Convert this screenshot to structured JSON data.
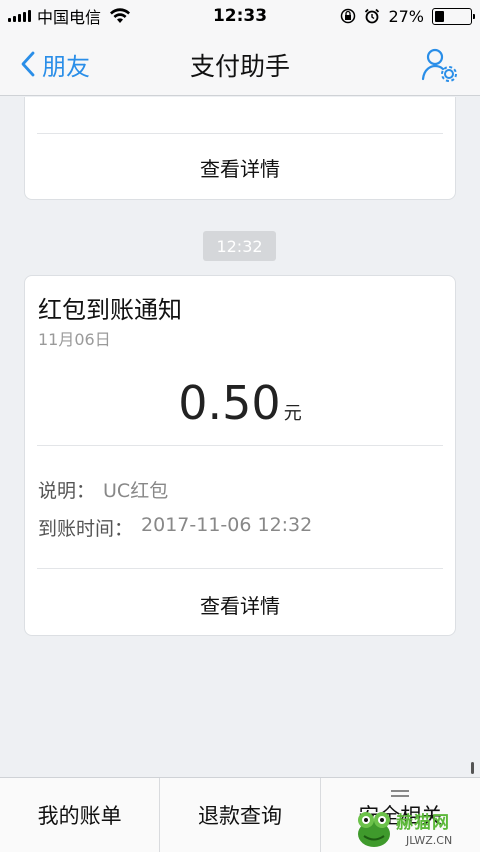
{
  "status_bar": {
    "carrier": "中国电信",
    "time": "12:33",
    "battery_percent": "27%",
    "battery_level": 0.27
  },
  "nav": {
    "back_label": "朋友",
    "title": "支付助手",
    "settings_icon": "user-settings-icon"
  },
  "previous_card": {
    "detail_label": "查看详情"
  },
  "time_chip": "12:32",
  "notice_card": {
    "title": "红包到账通知",
    "date": "11月06日",
    "amount": "0.50",
    "unit": "元",
    "desc_label": "说明：",
    "desc_value": "UC红包",
    "time_label": "到账时间：",
    "time_value": "2017-11-06 12:32",
    "detail_label": "查看详情"
  },
  "tabs": [
    {
      "label": "我的账单"
    },
    {
      "label": "退款查询"
    },
    {
      "label": "安全相关"
    }
  ],
  "watermark": {
    "text": "赫猫网",
    "sub": "JLWZ.CN"
  },
  "colors": {
    "accent": "#2a8ee8",
    "background": "#eef0f3",
    "card": "#ffffff",
    "watermark_green": "#5cb83a"
  }
}
